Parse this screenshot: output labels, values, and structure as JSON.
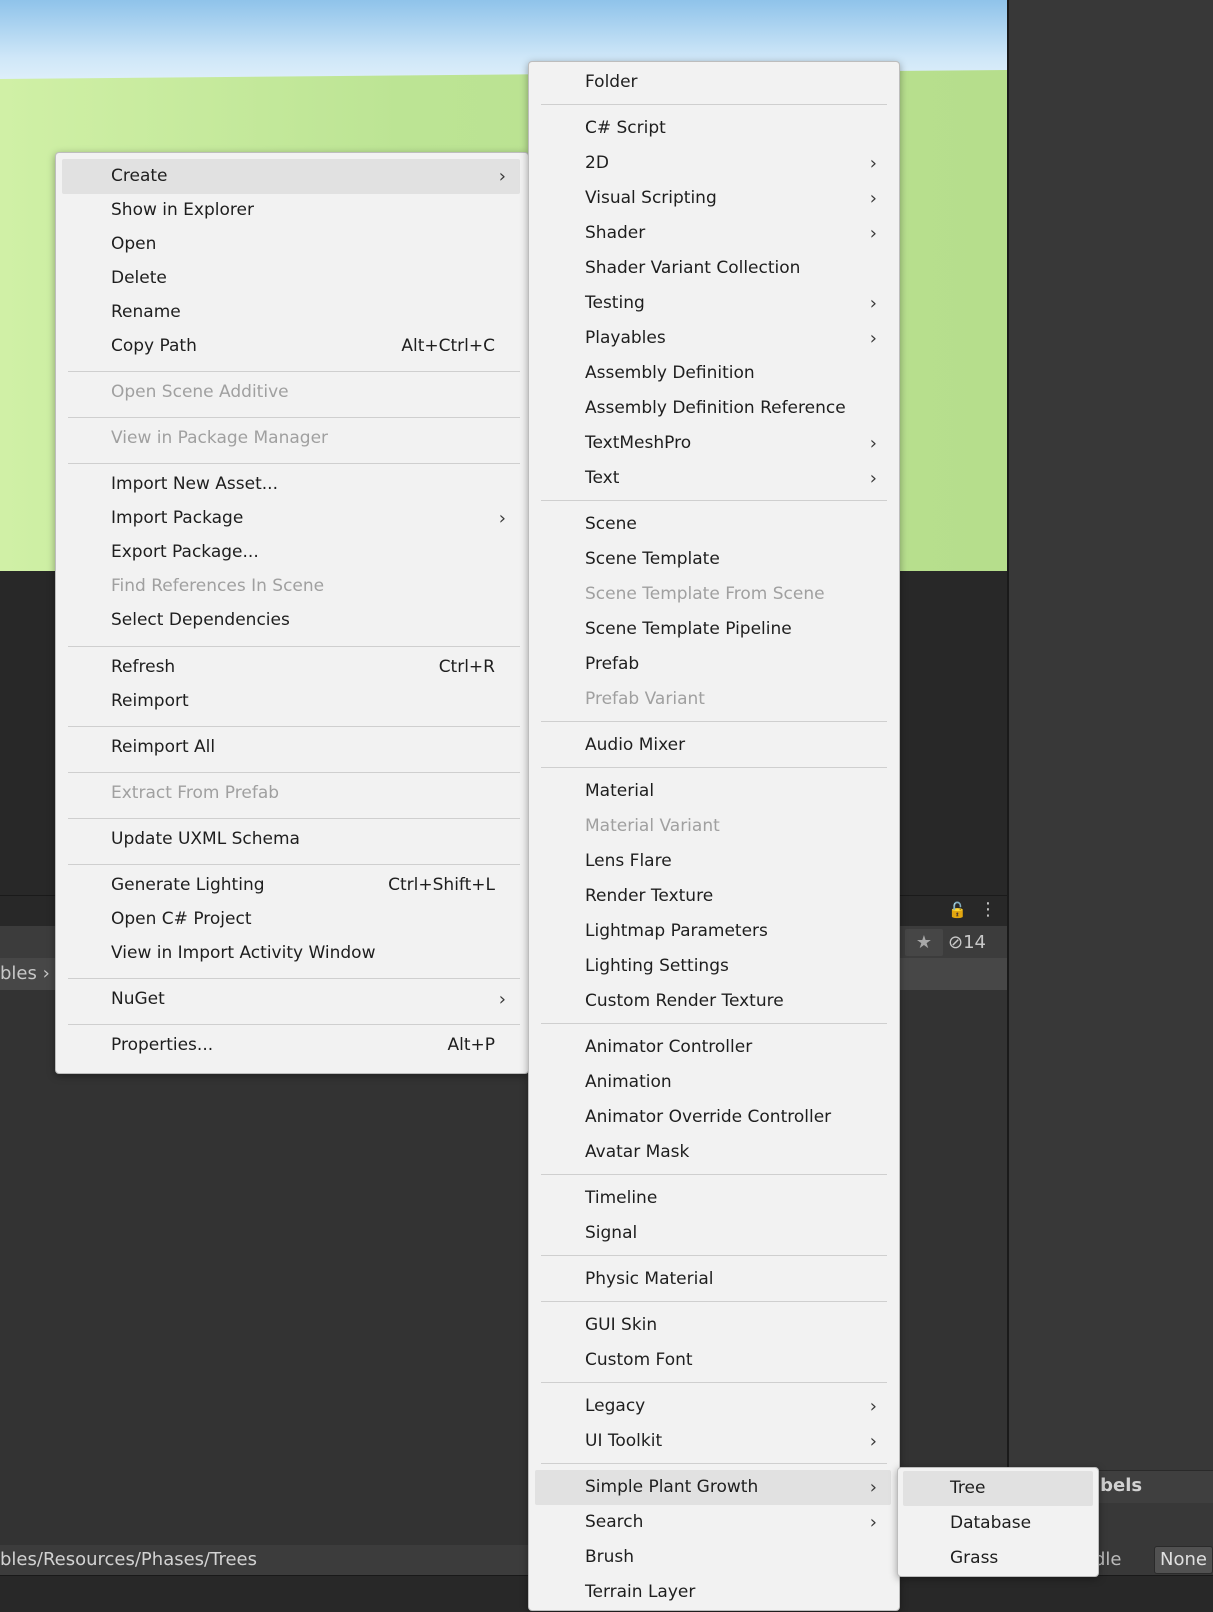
{
  "context_menu": {
    "create": "Create",
    "show_in_explorer": "Show in Explorer",
    "open": "Open",
    "delete": "Delete",
    "rename": "Rename",
    "copy_path": "Copy Path",
    "copy_path_shortcut": "Alt+Ctrl+C",
    "open_scene_additive": "Open Scene Additive",
    "view_in_package_manager": "View in Package Manager",
    "import_new_asset": "Import New Asset...",
    "import_package": "Import Package",
    "export_package": "Export Package...",
    "find_references_in_scene": "Find References In Scene",
    "select_dependencies": "Select Dependencies",
    "refresh": "Refresh",
    "refresh_shortcut": "Ctrl+R",
    "reimport": "Reimport",
    "reimport_all": "Reimport All",
    "extract_from_prefab": "Extract From Prefab",
    "update_uxml_schema": "Update UXML Schema",
    "generate_lighting": "Generate Lighting",
    "generate_lighting_shortcut": "Ctrl+Shift+L",
    "open_csharp_project": "Open C# Project",
    "view_in_import_activity_window": "View in Import Activity Window",
    "nuget": "NuGet",
    "properties": "Properties...",
    "properties_shortcut": "Alt+P"
  },
  "create_submenu": {
    "folder": "Folder",
    "csharp_script": "C# Script",
    "two_d": "2D",
    "visual_scripting": "Visual Scripting",
    "shader": "Shader",
    "shader_variant_collection": "Shader Variant Collection",
    "testing": "Testing",
    "playables": "Playables",
    "assembly_definition": "Assembly Definition",
    "assembly_definition_reference": "Assembly Definition Reference",
    "textmeshpro": "TextMeshPro",
    "text": "Text",
    "scene": "Scene",
    "scene_template": "Scene Template",
    "scene_template_from_scene": "Scene Template From Scene",
    "scene_template_pipeline": "Scene Template Pipeline",
    "prefab": "Prefab",
    "prefab_variant": "Prefab Variant",
    "audio_mixer": "Audio Mixer",
    "material": "Material",
    "material_variant": "Material Variant",
    "lens_flare": "Lens Flare",
    "render_texture": "Render Texture",
    "lightmap_parameters": "Lightmap Parameters",
    "lighting_settings": "Lighting Settings",
    "custom_render_texture": "Custom Render Texture",
    "animator_controller": "Animator Controller",
    "animation": "Animation",
    "animator_override_controller": "Animator Override Controller",
    "avatar_mask": "Avatar Mask",
    "timeline": "Timeline",
    "signal": "Signal",
    "physic_material": "Physic Material",
    "gui_skin": "GUI Skin",
    "custom_font": "Custom Font",
    "legacy": "Legacy",
    "ui_toolkit": "UI Toolkit",
    "simple_plant_growth": "Simple Plant Growth",
    "search": "Search",
    "brush": "Brush",
    "terrain_layer": "Terrain Layer"
  },
  "simple_plant_growth_submenu": {
    "tree": "Tree",
    "database": "Database",
    "grass": "Grass"
  },
  "background": {
    "breadcrumb_fragment": "bles",
    "path_fragment": "bles/Resources/Phases/Trees",
    "hidden_count": "14",
    "labels_fragment": "abels",
    "bundle_fragment": "dle",
    "asset_bundle_value": "None"
  },
  "glyphs": {
    "chevron": "›",
    "lock": "🔓",
    "more": "⋮",
    "star": "★",
    "eye_slash": "⊘"
  }
}
